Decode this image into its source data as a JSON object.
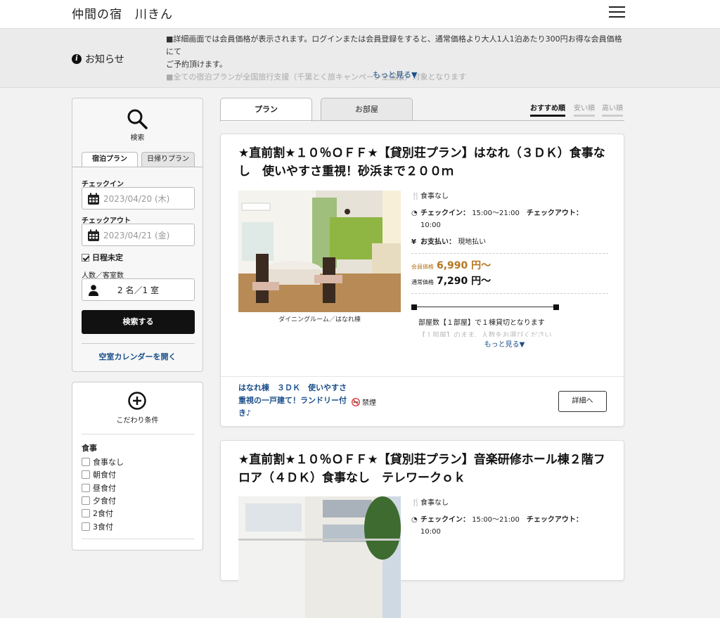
{
  "header": {
    "title": "仲間の宿　川きん"
  },
  "notice": {
    "label": "お知らせ",
    "line1": "■詳細画面では会員価格が表示されます。ログインまたは会員登録をすると、通常価格より大人1人1泊あたり300円お得な会員価格にて",
    "line2": "ご予約頂けます。",
    "line3": "■全ての宿泊プランが全国旅行支援（千葉とく旅キャンペーン全国版）対象となります",
    "more": "もっと見る▼"
  },
  "search": {
    "title": "検索",
    "tabs": [
      "宿泊プラン",
      "日帰りプラン"
    ],
    "checkin_label": "チェックイン",
    "checkin_value": "2023/04/20 (木)",
    "checkout_label": "チェックアウト",
    "checkout_value": "2023/04/21 (金)",
    "undecided": "日程未定",
    "guests_label": "人数／客室数",
    "guests_value": "2 名／1 室",
    "button": "検索する",
    "calendar_link": "空室カレンダーを開く"
  },
  "conditions": {
    "title": "こだわり条件",
    "meal_label": "食事",
    "meals": [
      "食事なし",
      "朝食付",
      "昼食付",
      "夕食付",
      "2食付",
      "3食付"
    ]
  },
  "main_tabs": [
    "プラン",
    "お部屋"
  ],
  "sort": [
    "おすすめ順",
    "安い順",
    "高い順"
  ],
  "plans": [
    {
      "title": "★直前割★１０％ＯＦＦ★【貸別荘プラン】はなれ（３ＤＫ）食事なし　使いやすさ重視！砂浜まで２００ｍ",
      "caption": "ダイニングルーム／はなれ棟",
      "meal": "食事なし",
      "checkin_label": "チェックイン：",
      "checkin_time": "15:00〜21:00",
      "checkout_label": "チェックアウト：",
      "checkout_time": "10:00",
      "payment_label": "お支払い：",
      "payment_value": "現地払い",
      "member_label": "会員価格",
      "member_price": "6,990 円〜",
      "regular_label": "通常価格",
      "regular_price": "7,290 円〜",
      "room_note": "部屋数【１部屋】で１棟貸切となります",
      "room_note2": "【１部屋】のまま、人数をお選びください",
      "more": "もっと見る▼",
      "footer_text": "はなれ棟　３ＤＫ　使いやすさ重視の一戸建て！ランドリー付き♪",
      "nosmoke": "禁煙",
      "detail": "詳細へ"
    },
    {
      "title": "★直前割★１０％ＯＦＦ★【貸別荘プラン】音楽研修ホール棟２階フロア（４ＤＫ）食事なし　テレワークｏｋ",
      "meal": "食事なし",
      "checkin_label": "チェックイン：",
      "checkin_time": "15:00〜21:00",
      "checkout_label": "チェックアウト：",
      "checkout_time": "10:00"
    }
  ]
}
